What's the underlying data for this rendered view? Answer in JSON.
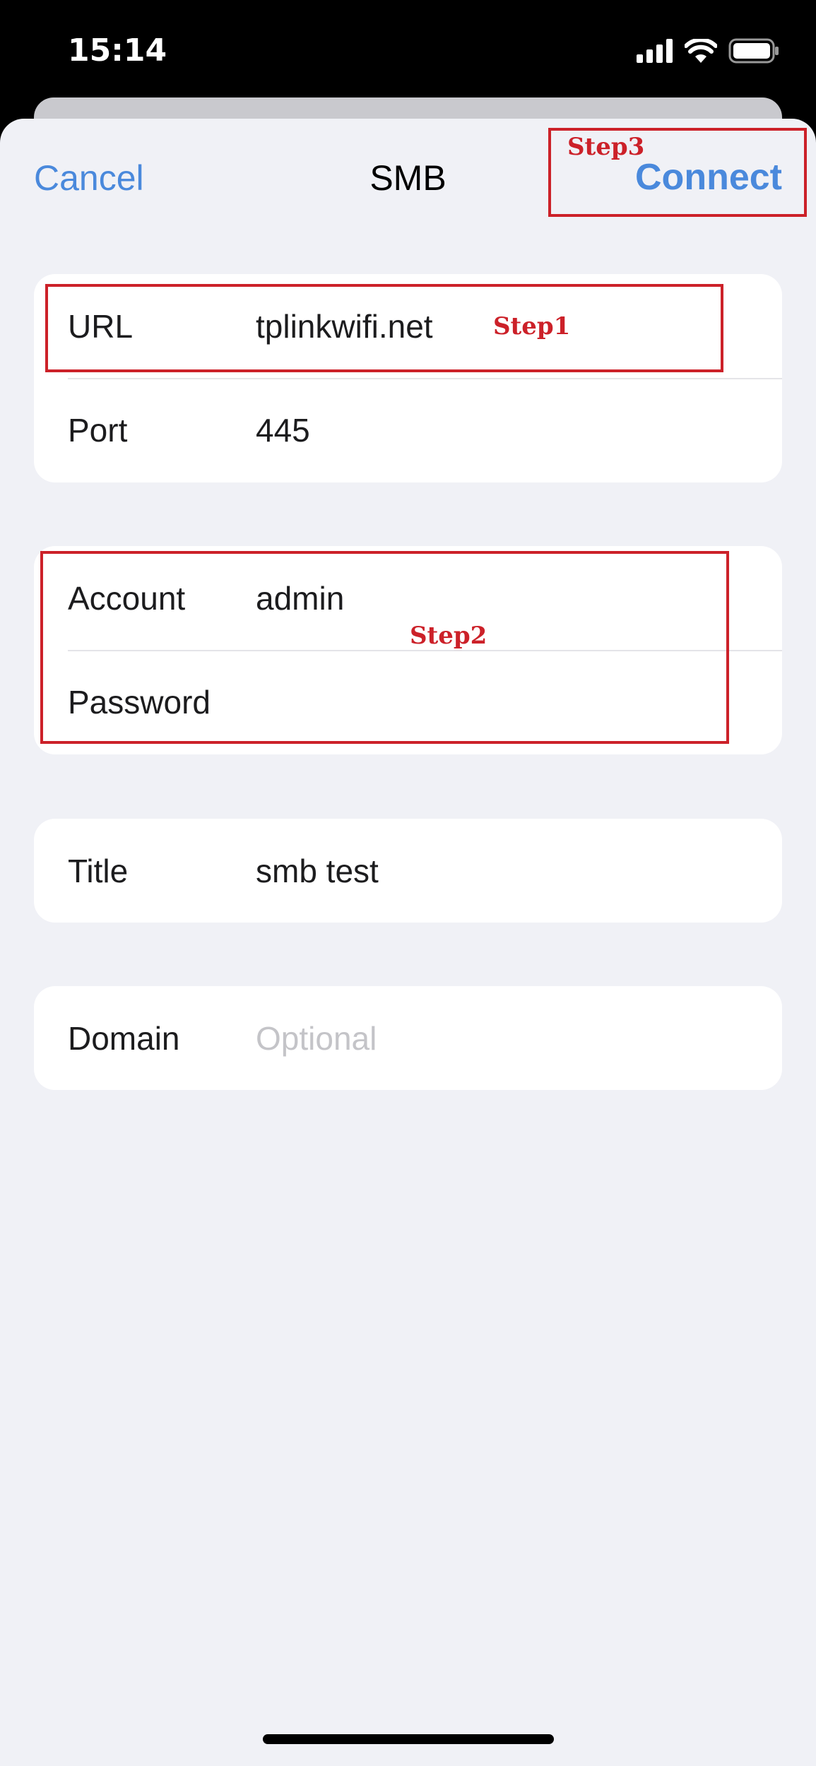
{
  "status_bar": {
    "time": "15:14",
    "icons": [
      "cellular-signal-icon",
      "wifi-icon",
      "battery-icon"
    ]
  },
  "nav": {
    "cancel_label": "Cancel",
    "title": "SMB",
    "connect_label": "Connect"
  },
  "server_group": {
    "url": {
      "label": "URL",
      "value": "tplinkwifi.net"
    },
    "port": {
      "label": "Port",
      "value": "445"
    }
  },
  "credentials_group": {
    "account": {
      "label": "Account",
      "value": "admin"
    },
    "password": {
      "label": "Password",
      "value": ""
    }
  },
  "title_group": {
    "title": {
      "label": "Title",
      "value": "smb test"
    }
  },
  "domain_group": {
    "domain": {
      "label": "Domain",
      "value": "",
      "placeholder": "Optional"
    }
  },
  "annotations": {
    "step1": "Step1",
    "step2": "Step2",
    "step3": "Step3"
  },
  "colors": {
    "accent": "#4a89dc",
    "annotation": "#cc2129",
    "sheet_background": "#f0f1f6",
    "placeholder": "#c4c4c8"
  }
}
